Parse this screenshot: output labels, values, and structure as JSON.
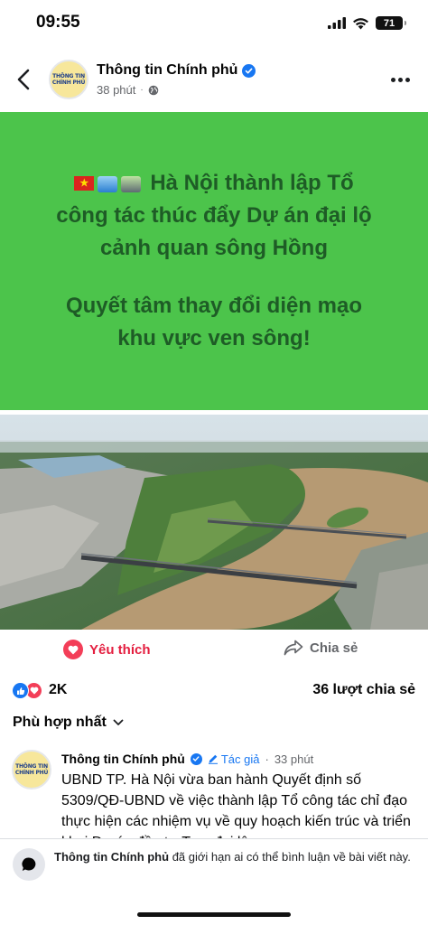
{
  "status_bar": {
    "time": "09:55",
    "battery": "71"
  },
  "post": {
    "page_name": "Thông tin Chính phủ",
    "avatar_text": [
      "THÔNG TIN",
      "CHÍNH PHỦ"
    ],
    "time": "38 phút",
    "privacy_icon": "globe-icon"
  },
  "banner": {
    "background": "#4cc44b",
    "text_color": "#1e5c26",
    "headline_lines": [
      "Hà Nội thành lập Tổ",
      "công tác thúc đẩy Dự án đại lộ",
      "cảnh quan sông Hồng"
    ],
    "subline_lines": [
      "Quyết tâm thay đổi diện mạo",
      "khu vực ven sông!"
    ]
  },
  "actions": {
    "like_label": "Yêu thích",
    "like_color": "#e41e3f",
    "share_label": "Chia sẻ"
  },
  "reactions": {
    "count": "2K",
    "shares": "36 lượt chia sẻ"
  },
  "sort": {
    "label": "Phù hợp nhất"
  },
  "comment": {
    "author": "Thông tin Chính phủ",
    "author_tag": "Tác giả",
    "time": "33 phút",
    "text": "UBND TP. Hà Nội vừa ban hành Quyết định số 5309/QĐ-UBND về việc thành lập Tổ công tác chỉ đạo thực hiện các nhiệm vụ về quy hoạch kiến trúc và triển khai Dự án đầu tư Trục đại lộ"
  },
  "notice": {
    "page_name": "Thông tin Chính phủ",
    "text": " đã giới hạn ai có thể bình luận về bài viết này."
  }
}
